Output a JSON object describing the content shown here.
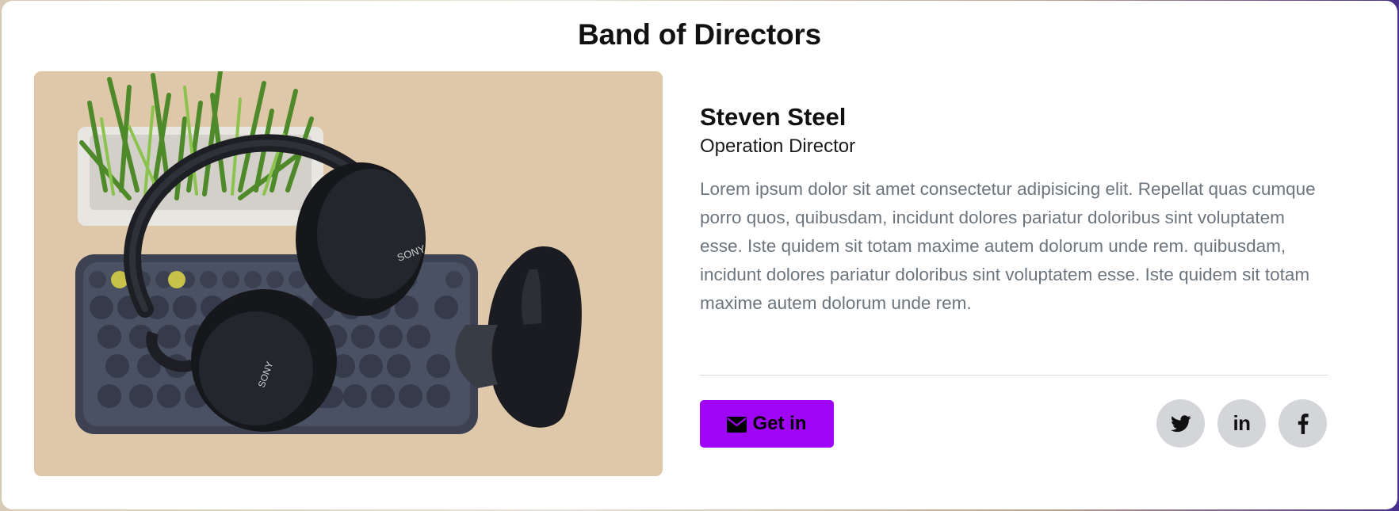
{
  "section": {
    "title": "Band of Directors"
  },
  "director": {
    "name": "Steven Steel",
    "role": "Operation Director",
    "bio": "Lorem ipsum dolor sit amet consectetur adipisicing elit. Repellat quas cumque porro quos, quibusdam, incidunt dolores pariatur doloribus sint voluptatem esse. Iste quidem sit totam maxime autem dolorum unde rem. quibusdam, incidunt dolores pariatur doloribus sint voluptatem esse. Iste quidem sit totam maxime autem dolorum unde rem.",
    "photo_icon": "headphones-keyboard-mouse-photo"
  },
  "actions": {
    "get_in_label": "Get in",
    "get_in_icon": "envelope-icon"
  },
  "social": [
    {
      "name": "twitter",
      "icon": "twitter-icon"
    },
    {
      "name": "linkedin",
      "icon": "linkedin-icon",
      "glyph": "in"
    },
    {
      "name": "facebook",
      "icon": "facebook-icon"
    }
  ],
  "colors": {
    "accent": "#9f06f5",
    "social_bg": "#d3d5d9",
    "bio_text": "#6c757d",
    "card_bg": "#ffffff"
  }
}
